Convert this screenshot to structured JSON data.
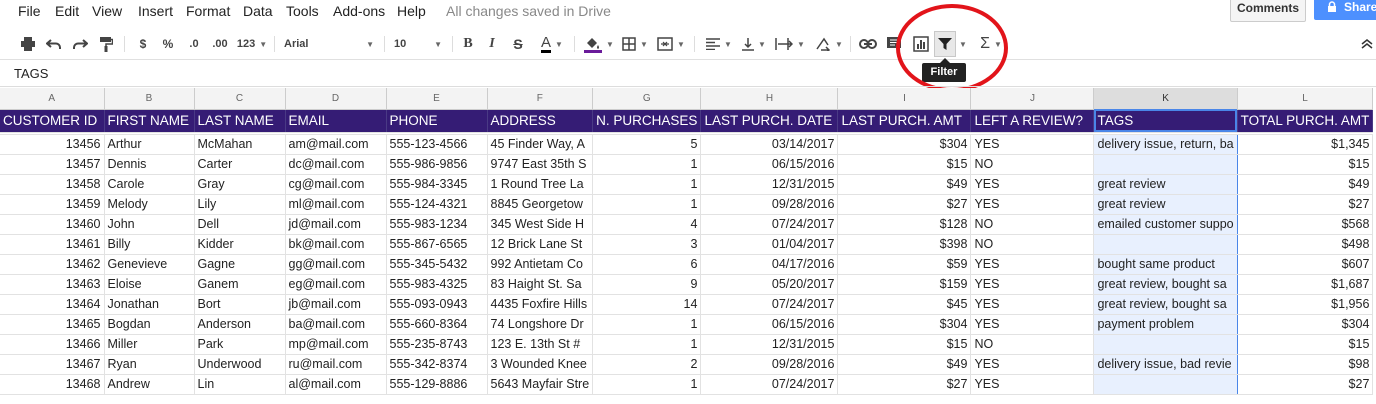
{
  "menu": [
    "File",
    "Edit",
    "View",
    "Insert",
    "Format",
    "Data",
    "Tools",
    "Add-ons",
    "Help"
  ],
  "status": "All changes saved in Drive",
  "comments_label": "Comments",
  "share_label": "Share",
  "toolbar": {
    "currency": "$",
    "percent": "%",
    "dec_less": ".0",
    "dec_more": ".00",
    "more_formats": "123",
    "font": "Arial",
    "font_size": "10",
    "bold": "B",
    "italic": "I",
    "strike": "S",
    "text_color": "A",
    "sigma": "Σ"
  },
  "tooltip": "Filter",
  "formula_value": "TAGS",
  "columns": [
    "A",
    "B",
    "C",
    "D",
    "E",
    "F",
    "G",
    "H",
    "I",
    "J",
    "K",
    "L"
  ],
  "headers": [
    "CUSTOMER ID",
    "FIRST NAME",
    "LAST NAME",
    "EMAIL",
    "PHONE",
    "ADDRESS",
    "N. PURCHASES",
    "LAST PURCH. DATE",
    "LAST PURCH. AMT",
    "LEFT A REVIEW?",
    "TAGS",
    "TOTAL PURCH. AMT"
  ],
  "rows": [
    [
      "13456",
      "Arthur",
      "McMahan",
      "am@mail.com",
      "555-123-4566",
      "45 Finder Way, A",
      "5",
      "03/14/2017",
      "$304",
      "YES",
      "delivery issue, return, ba",
      "$1,345"
    ],
    [
      "13457",
      "Dennis",
      "Carter",
      "dc@mail.com",
      "555-986-9856",
      "9747 East 35th S",
      "1",
      "06/15/2016",
      "$15",
      "NO",
      "",
      "$15"
    ],
    [
      "13458",
      "Carole",
      "Gray",
      "cg@mail.com",
      "555-984-3345",
      "1 Round Tree La",
      "1",
      "12/31/2015",
      "$49",
      "YES",
      "great review",
      "$49"
    ],
    [
      "13459",
      "Melody",
      "Lily",
      "ml@mail.com",
      "555-124-4321",
      "8845 Georgetow",
      "1",
      "09/28/2016",
      "$27",
      "YES",
      "great review",
      "$27"
    ],
    [
      "13460",
      "John",
      "Dell",
      "jd@mail.com",
      "555-983-1234",
      "345 West Side H",
      "4",
      "07/24/2017",
      "$128",
      "NO",
      "emailed customer suppo",
      "$568"
    ],
    [
      "13461",
      "Billy",
      "Kidder",
      "bk@mail.com",
      "555-867-6565",
      "12 Brick Lane St",
      "3",
      "01/04/2017",
      "$398",
      "NO",
      "",
      "$498"
    ],
    [
      "13462",
      "Genevieve",
      "Gagne",
      "gg@mail.com",
      "555-345-5432",
      "992 Antietam Co",
      "6",
      "04/17/2016",
      "$59",
      "YES",
      "bought same product",
      "$607"
    ],
    [
      "13463",
      "Eloise",
      "Ganem",
      "eg@mail.com",
      "555-983-4325",
      "83 Haight St. Sa",
      "9",
      "05/20/2017",
      "$159",
      "YES",
      "great review, bought sa",
      "$1,687"
    ],
    [
      "13464",
      "Jonathan",
      "Bort",
      "jb@mail.com",
      "555-093-0943",
      "4435 Foxfire Hills",
      "14",
      "07/24/2017",
      "$45",
      "YES",
      "great review, bought sa",
      "$1,956"
    ],
    [
      "13465",
      "Bogdan",
      "Anderson",
      "ba@mail.com",
      "555-660-8364",
      "74 Longshore Dr",
      "1",
      "06/15/2016",
      "$304",
      "YES",
      "payment problem",
      "$304"
    ],
    [
      "13466",
      "Miller",
      "Park",
      "mp@mail.com",
      "555-235-8743",
      "123 E. 13th St #",
      "1",
      "12/31/2015",
      "$15",
      "NO",
      "",
      "$15"
    ],
    [
      "13467",
      "Ryan",
      "Underwood",
      "ru@mail.com",
      "555-342-8374",
      "3 Wounded Knee",
      "2",
      "09/28/2016",
      "$49",
      "YES",
      "delivery issue, bad revie",
      "$98"
    ],
    [
      "13468",
      "Andrew",
      "Lin",
      "al@mail.com",
      "555-129-8886",
      "5643 Mayfair Stre",
      "1",
      "07/24/2017",
      "$27",
      "YES",
      "",
      "$27"
    ]
  ]
}
